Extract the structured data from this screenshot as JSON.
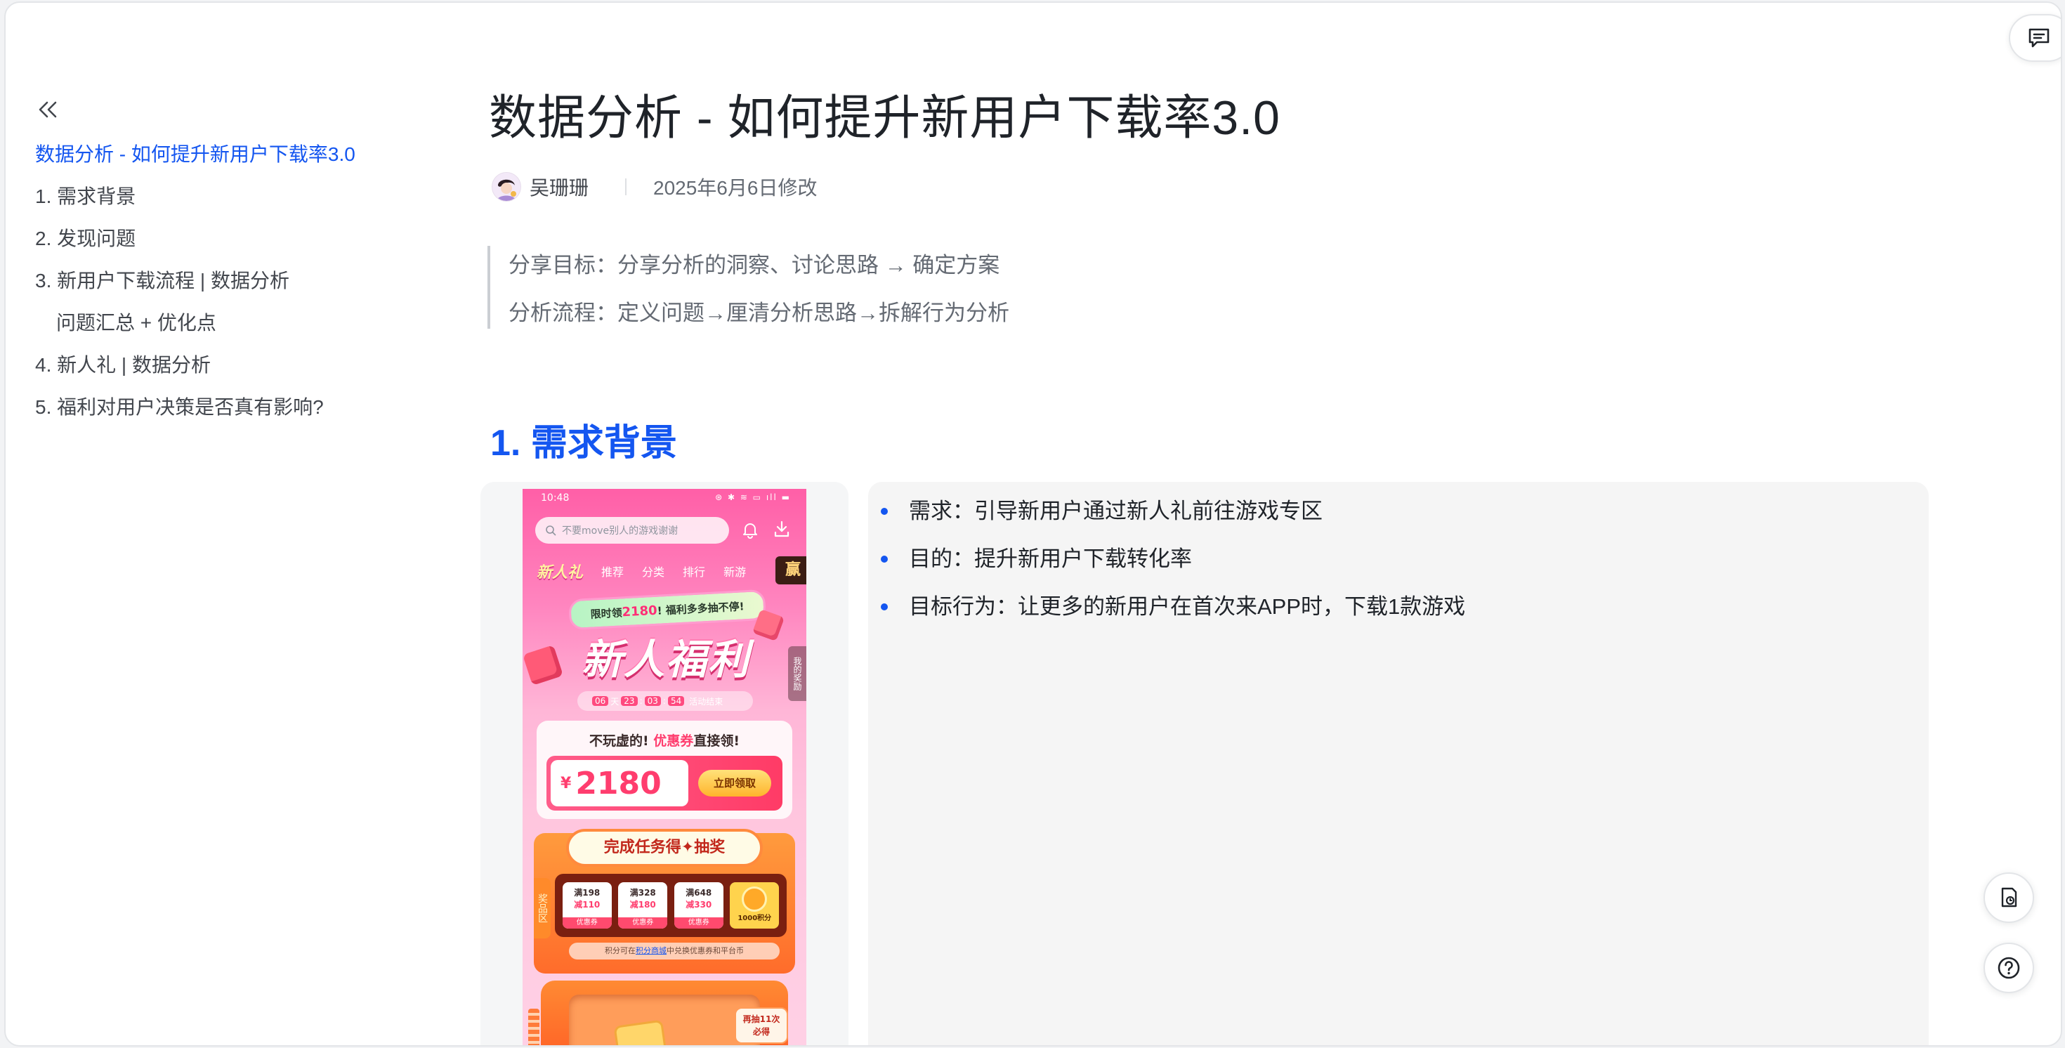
{
  "toc": {
    "items": [
      {
        "label": "数据分析 - 如何提升新用户下载率3.0",
        "active": true
      },
      {
        "label": "1. 需求背景"
      },
      {
        "label": "2. 发现问题"
      },
      {
        "label": "3. 新用户下载流程 | 数据分析"
      },
      {
        "label": "问题汇总 + 优化点",
        "sub": true
      },
      {
        "label": "4. 新人礼 | 数据分析"
      },
      {
        "label": "5. 福利对用户决策是否真有影响?"
      }
    ]
  },
  "doc": {
    "title": "数据分析 - 如何提升新用户下载率3.0",
    "author": "吴珊珊",
    "modified": "2025年6月6日修改",
    "quote": [
      "分享目标：分享分析的洞察、讨论思路 → 确定方案",
      "分析流程：定义问题→厘清分析思路→拆解行为分析"
    ],
    "section1_heading": "1. 需求背景",
    "bullets": [
      "需求：引导新用户通过新人礼前往游戏专区",
      "目的：提升新用户下载转化率",
      "目标行为：让更多的新用户在首次来APP时，下载1款游戏"
    ]
  },
  "phone": {
    "time": "10:48",
    "status_icons": "⊛ ✱ ≋ ▭ ıll ▬",
    "search_placeholder": "不要move别人的游戏谢谢",
    "brand": "新人礼",
    "tabs": [
      "推荐",
      "分类",
      "排行",
      "新游"
    ],
    "win": "赢",
    "pill_prefix": "限时领",
    "pill_number": "2180",
    "pill_suffix": "! 福利多多抽不停!",
    "big_title": "新人福利",
    "side_label": "我的奖励",
    "countdown": {
      "d": "06",
      "d_unit": "天",
      "h": "23",
      "m": "03",
      "s": "54",
      "end": "活动结束"
    },
    "coupon_head_prefix": "不玩虚的! ",
    "coupon_head_highlight": "优惠券",
    "coupon_head_suffix": "直接领!",
    "yen": "¥",
    "amount": "2180",
    "claim": "立即领取",
    "task_title": "完成任务得✦抽奖",
    "zone": "奖品区",
    "prizes": [
      {
        "l1": "满198",
        "l2": "减110",
        "l3": "优惠券"
      },
      {
        "l1": "满328",
        "l2": "减180",
        "l3": "优惠券"
      },
      {
        "l1": "满648",
        "l2": "减330",
        "l3": "优惠券"
      }
    ],
    "points": "1000积分",
    "note_prefix": "积分可在",
    "note_link": "积分商城",
    "note_suffix": "中兑换优惠券和平台币",
    "draw_tag_1": "再抽11次",
    "draw_tag_2": "必得"
  },
  "colors": {
    "accent": "#1456f0",
    "text": "#1f2329",
    "muted": "#646a73"
  },
  "icons": {
    "toc_collapse": "double-chevron-left-icon",
    "comment": "comment-icon",
    "history": "document-history-icon",
    "help": "help-icon"
  }
}
